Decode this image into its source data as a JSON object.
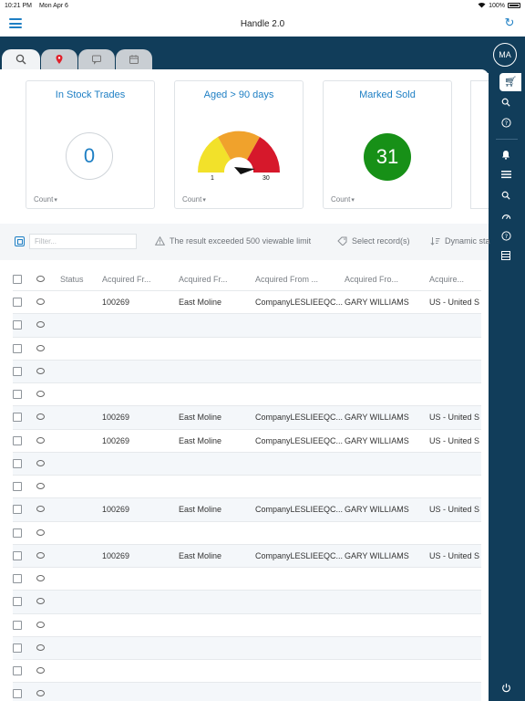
{
  "statusbar": {
    "time": "10:21 PM",
    "date": "Mon Apr 6",
    "battery": "100%"
  },
  "app": {
    "title": "Handle 2.0"
  },
  "tabs": [
    {
      "icon": "search-icon"
    },
    {
      "icon": "location-pin-icon"
    },
    {
      "icon": "chat-icon"
    },
    {
      "icon": "calendar-icon"
    }
  ],
  "sidebar": {
    "avatar": "MA"
  },
  "cards": {
    "stock": {
      "title": "In Stock Trades",
      "value": "0",
      "footer": "Count"
    },
    "aged": {
      "title": "Aged > 90 days",
      "gauge_min": "1",
      "gauge_max": "30",
      "footer": "Count",
      "colors": [
        "#f2e12a",
        "#f0a22c",
        "#d6182b"
      ]
    },
    "sold": {
      "title": "Marked Sold",
      "value": "31",
      "footer": "Count",
      "color": "#179017"
    }
  },
  "toolbar": {
    "filter_placeholder": "Filter...",
    "warning": "The result exceeded 500 viewable limit",
    "select": "Select record(s)",
    "dynamic": "Dynamic sta"
  },
  "table": {
    "headers": [
      "Status",
      "Acquired Fr...",
      "Acquired Fr...",
      "Acquired From ...",
      "Acquired Fro...",
      "Acquire..."
    ],
    "rows": [
      [
        "",
        "100269",
        "East Moline",
        "CompanyLESLIEEQC...",
        "GARY WILLIAMS",
        "US - United S"
      ],
      [
        "",
        "",
        "",
        "",
        "",
        ""
      ],
      [
        "",
        "",
        "",
        "",
        "",
        ""
      ],
      [
        "",
        "",
        "",
        "",
        "",
        ""
      ],
      [
        "",
        "",
        "",
        "",
        "",
        ""
      ],
      [
        "",
        "100269",
        "East Moline",
        "CompanyLESLIEEQC...",
        "GARY WILLIAMS",
        "US - United S"
      ],
      [
        "",
        "100269",
        "East Moline",
        "CompanyLESLIEEQC...",
        "GARY WILLIAMS",
        "US - United S"
      ],
      [
        "",
        "",
        "",
        "",
        "",
        ""
      ],
      [
        "",
        "",
        "",
        "",
        "",
        ""
      ],
      [
        "",
        "100269",
        "East Moline",
        "CompanyLESLIEEQC...",
        "GARY WILLIAMS",
        "US - United S"
      ],
      [
        "",
        "",
        "",
        "",
        "",
        ""
      ],
      [
        "",
        "100269",
        "East Moline",
        "CompanyLESLIEEQC...",
        "GARY WILLIAMS",
        "US - United S"
      ],
      [
        "",
        "",
        "",
        "",
        "",
        ""
      ],
      [
        "",
        "",
        "",
        "",
        "",
        ""
      ],
      [
        "",
        "",
        "",
        "",
        "",
        ""
      ],
      [
        "",
        "",
        "",
        "",
        "",
        ""
      ],
      [
        "",
        "",
        "",
        "",
        "",
        ""
      ],
      [
        "",
        "",
        "",
        "",
        "",
        ""
      ]
    ]
  }
}
